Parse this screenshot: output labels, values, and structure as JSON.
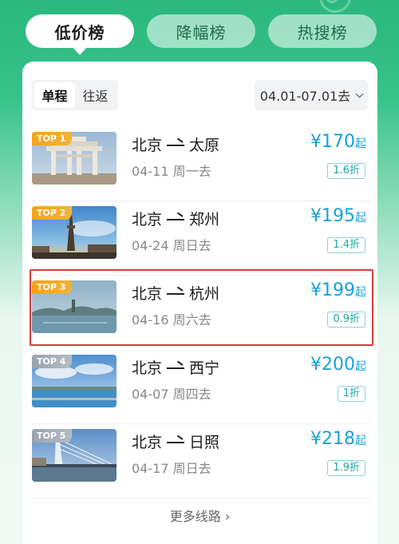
{
  "tabs": [
    {
      "label": "低价榜",
      "active": true
    },
    {
      "label": "降幅榜",
      "active": false
    },
    {
      "label": "热搜榜",
      "active": false
    }
  ],
  "trip_type": {
    "one_way": "单程",
    "round_trip": "往返",
    "selected": "单程"
  },
  "date_range": "04.01-07.01去",
  "routes": [
    {
      "rank": "TOP 1",
      "from": "北京",
      "to": "太原",
      "date": "04-11 周一去",
      "price": "¥170",
      "price_suffix": "起",
      "discount": "1.6折",
      "image": "archway-photo"
    },
    {
      "rank": "TOP 2",
      "from": "北京",
      "to": "郑州",
      "date": "04-24 周日去",
      "price": "¥195",
      "price_suffix": "起",
      "discount": "1.4折",
      "image": "tower-photo"
    },
    {
      "rank": "TOP 3",
      "from": "北京",
      "to": "杭州",
      "date": "04-16 周六去",
      "price": "¥199",
      "price_suffix": "起",
      "discount": "0.9折",
      "image": "lake-photo"
    },
    {
      "rank": "TOP 4",
      "from": "北京",
      "to": "西宁",
      "date": "04-07 周四去",
      "price": "¥200",
      "price_suffix": "起",
      "discount": "1折",
      "image": "lake-sky-photo"
    },
    {
      "rank": "TOP 5",
      "from": "北京",
      "to": "日照",
      "date": "04-17 周日去",
      "price": "¥218",
      "price_suffix": "起",
      "discount": "1.9折",
      "image": "bridge-photo"
    }
  ],
  "more_routes": "更多线路",
  "colors": {
    "brand": "#2bb87e",
    "price": "#1aa0d8",
    "discount": "#1fa7a1",
    "highlight": "#d93c3c"
  }
}
